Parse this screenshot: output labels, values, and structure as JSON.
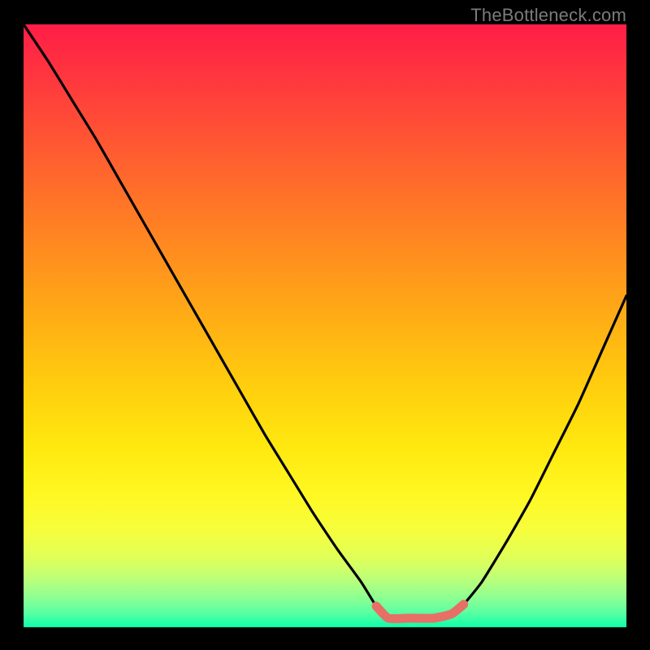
{
  "watermark": "TheBottleneck.com",
  "gradient": {
    "stops": [
      {
        "offset": 0.0,
        "color": "#ff1d47"
      },
      {
        "offset": 0.1,
        "color": "#ff3a3d"
      },
      {
        "offset": 0.2,
        "color": "#ff5832"
      },
      {
        "offset": 0.3,
        "color": "#ff7627"
      },
      {
        "offset": 0.4,
        "color": "#ff931d"
      },
      {
        "offset": 0.5,
        "color": "#ffb114"
      },
      {
        "offset": 0.6,
        "color": "#ffce0e"
      },
      {
        "offset": 0.7,
        "color": "#ffe80f"
      },
      {
        "offset": 0.78,
        "color": "#fff823"
      },
      {
        "offset": 0.84,
        "color": "#f6fe3d"
      },
      {
        "offset": 0.88,
        "color": "#e2ff55"
      },
      {
        "offset": 0.905,
        "color": "#cdff6b"
      },
      {
        "offset": 0.925,
        "color": "#b4ff7e"
      },
      {
        "offset": 0.945,
        "color": "#97ff8e"
      },
      {
        "offset": 0.962,
        "color": "#77ff9a"
      },
      {
        "offset": 0.978,
        "color": "#53ffa2"
      },
      {
        "offset": 0.99,
        "color": "#2effa6"
      },
      {
        "offset": 1.0,
        "color": "#0bffa7"
      }
    ]
  },
  "accent_color": "#e76f66",
  "chart_data": {
    "type": "line",
    "title": "",
    "xlabel": "",
    "ylabel": "",
    "xlim": [
      0,
      100
    ],
    "ylim": [
      0,
      100
    ],
    "grid": false,
    "series": [
      {
        "name": "bottleneck-curve",
        "x": [
          0,
          4,
          8,
          12,
          16,
          20,
          24,
          28,
          32,
          36,
          40,
          44,
          48,
          52,
          56,
          58.5,
          60.5,
          64,
          68,
          71,
          73,
          76,
          80,
          84,
          88,
          92,
          96,
          100
        ],
        "y": [
          100,
          94,
          87.5,
          81,
          74,
          67,
          60,
          53,
          46,
          39,
          32,
          25.5,
          19,
          13,
          7.5,
          3.5,
          1.5,
          1.5,
          1.5,
          2.2,
          3.8,
          7.5,
          14,
          21,
          29,
          37,
          46,
          55
        ]
      },
      {
        "name": "flat-floor-highlight",
        "x": [
          58.5,
          60.5,
          64,
          68,
          71,
          73
        ],
        "y": [
          3.5,
          1.5,
          1.5,
          1.5,
          2.2,
          3.8
        ]
      }
    ]
  }
}
